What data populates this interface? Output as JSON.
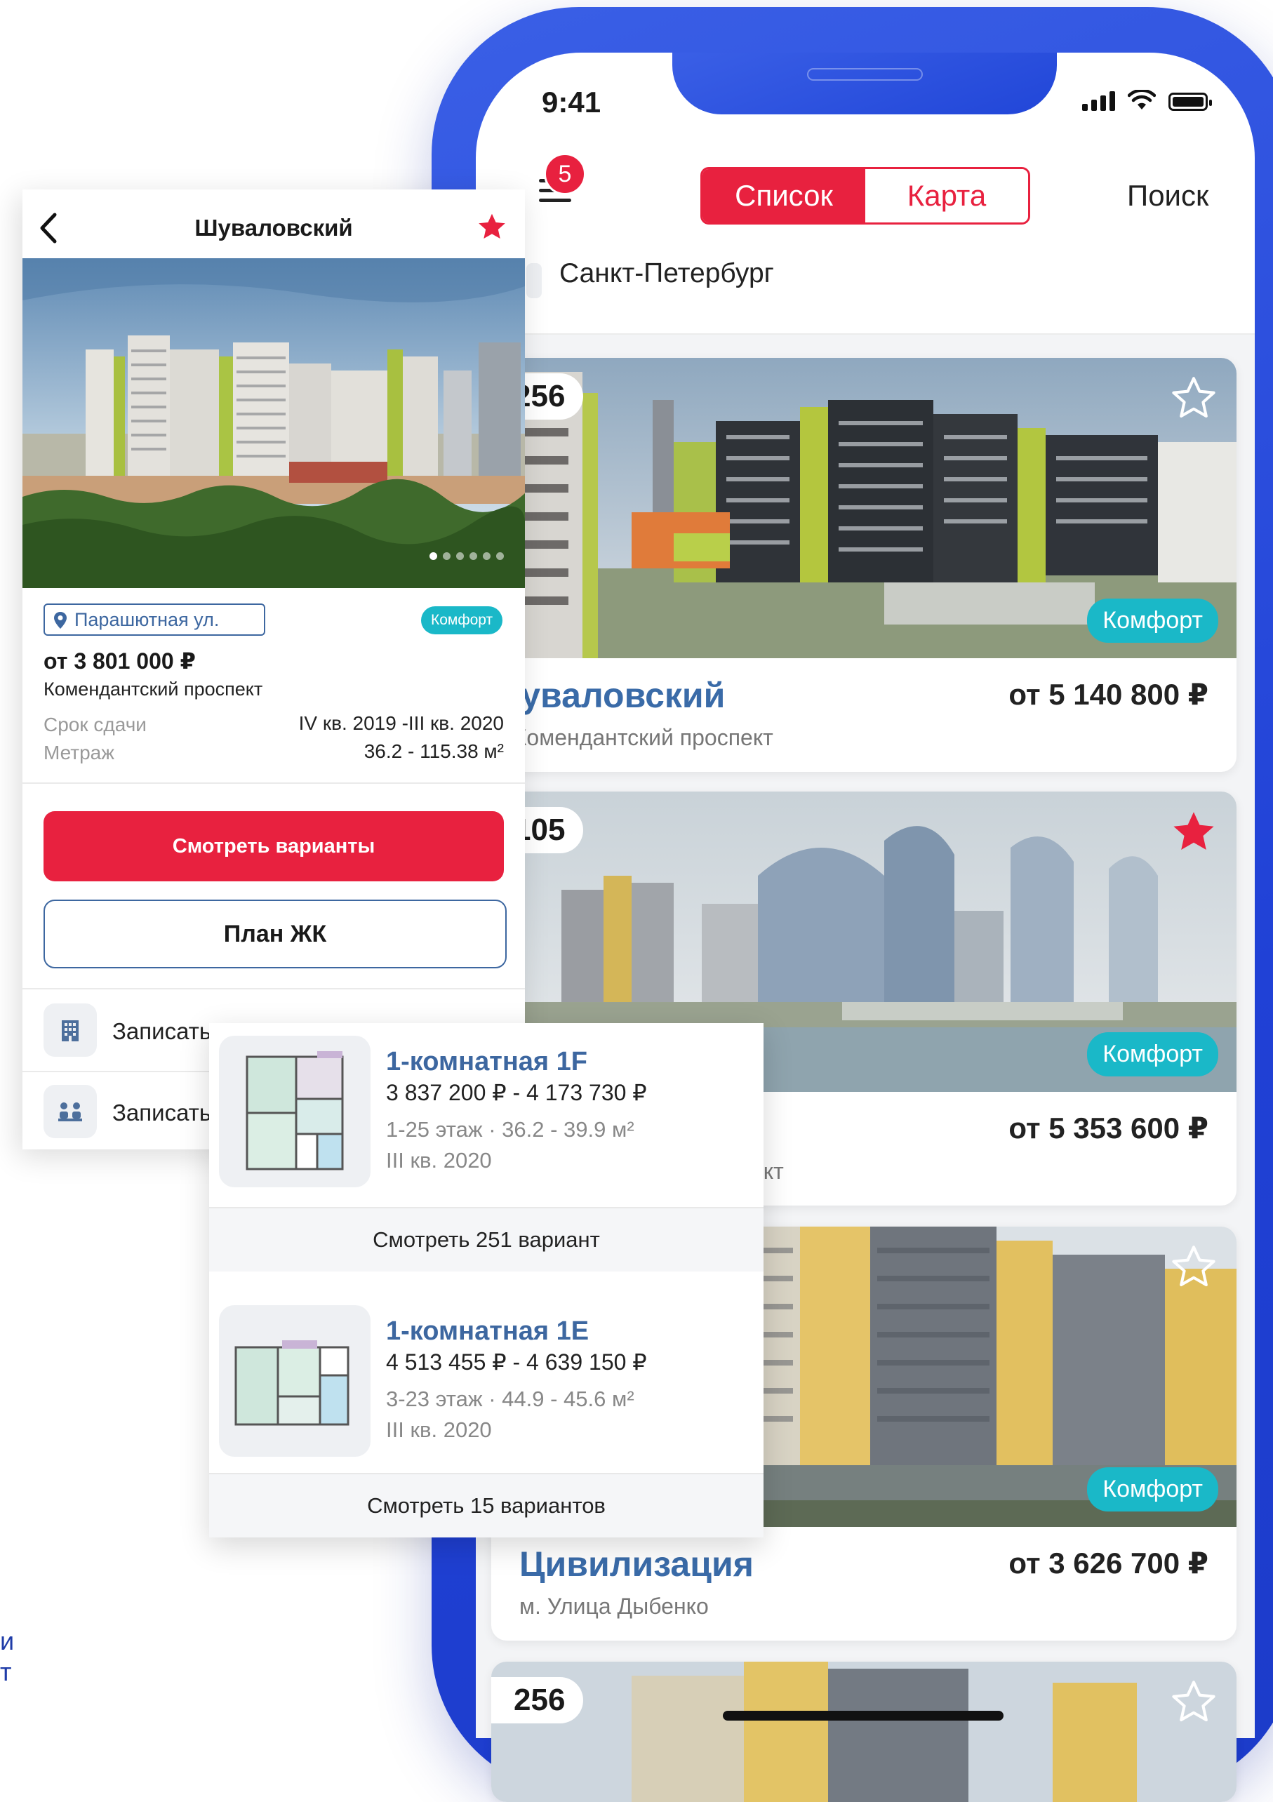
{
  "status_bar": {
    "time": "9:41"
  },
  "header": {
    "menu_badge": "5",
    "tabs": [
      {
        "label": "Список",
        "active": true
      },
      {
        "label": "Карта",
        "active": false
      }
    ],
    "search_label": "Поиск",
    "city": "Санкт-Петербург"
  },
  "listings": [
    {
      "count": "256",
      "favorite": false,
      "class_badge": "Комфорт",
      "name": "Шуваловский",
      "metro": "м. Комендантский проспект",
      "price": "от 5 140 800 ₽"
    },
    {
      "count": "105",
      "favorite": true,
      "class_badge": "Комфорт",
      "name": "",
      "metro": "ект",
      "price": "от 5 353 600 ₽"
    },
    {
      "count": "",
      "favorite": false,
      "class_badge": "Комфорт",
      "name": "Цивилизация",
      "metro": "м. Улица Дыбенко",
      "price": "от 3 626 700 ₽"
    },
    {
      "count": "256",
      "favorite": false
    }
  ],
  "detail": {
    "title": "Шуваловский",
    "favorite": true,
    "address": "Парашютная ул.",
    "class_badge": "Комфорт",
    "price": "от 3 801 000 ₽",
    "metro": "Комендантский проспект",
    "rows": [
      {
        "label": "Срок сдачи",
        "value": "IV кв. 2019 -III кв. 2020"
      },
      {
        "label": "Метраж",
        "value": "36.2 - 115.38 м²"
      }
    ],
    "primary_button": "Смотреть варианты",
    "secondary_button": "План ЖК",
    "actions": [
      {
        "icon": "building-icon",
        "label": "Записать"
      },
      {
        "icon": "meeting-icon",
        "label": "Записать"
      }
    ]
  },
  "apartments": [
    {
      "name": "1-комнатная 1F",
      "price": "3 837 200 ₽ - 4 173 730 ₽",
      "meta": "1-25 этаж · 36.2 - 39.9 м²",
      "quarter": "III кв. 2020",
      "more": "Смотреть 251 вариант"
    },
    {
      "name": "1-комнатная 1E",
      "price": "4 513 455 ₽ - 4 639 150 ₽",
      "meta": "3-23 этаж · 44.9 - 45.6 м²",
      "quarter": "III кв. 2020",
      "more": "Смотреть 15 вариантов"
    }
  ],
  "edge_text": {
    "line1": "и",
    "line2": "т"
  },
  "colors": {
    "brand_red": "#e8213f",
    "accent_blue": "#3d67a0",
    "comfort_teal": "#1ab8c8",
    "phone_blue": "#2146d8"
  }
}
